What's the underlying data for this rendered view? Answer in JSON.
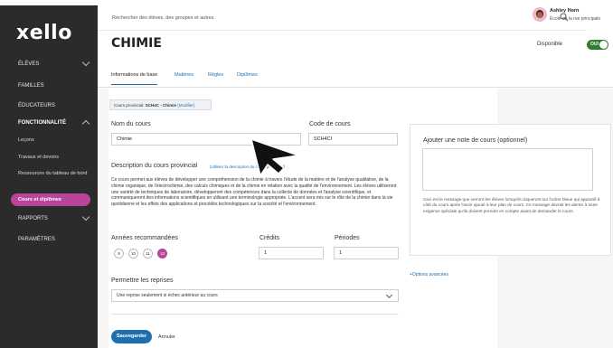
{
  "app": {
    "logo": "xello"
  },
  "sidebar": {
    "items": [
      {
        "label": "ÉLÈVES"
      },
      {
        "label": "FAMILLES"
      },
      {
        "label": "ÉDUCATEURS"
      },
      {
        "label": "FONCTIONNALITÉ"
      },
      {
        "label": "Leçons"
      },
      {
        "label": "Travaux et devoirs"
      },
      {
        "label": "Ressources du tableau de bord"
      },
      {
        "label": "Cours et diplômes"
      },
      {
        "label": "RAPPORTS"
      },
      {
        "label": "PARAMÈTRES"
      }
    ]
  },
  "header": {
    "search_placeholder": "Rechercher des élèves, des groupes et autres",
    "user_name": "Ashley Horn",
    "user_school": "École de la rue principale"
  },
  "page": {
    "title": "CHIMIE",
    "availability_label": "Disponible",
    "toggle_label": "OUI"
  },
  "tabs": [
    {
      "label": "Informations de base"
    },
    {
      "label": "Matières"
    },
    {
      "label": "Règles"
    },
    {
      "label": "Diplômes"
    }
  ],
  "form": {
    "prov_prefix": "Cours provincial: ",
    "prov_code": "SCH4C - Chimie",
    "prov_modify": "(Modifier)",
    "course_name_label": "Nom du cours",
    "course_name_value": "Chimie",
    "course_code_label": "Code de cours",
    "course_code_value": "SCH4CI",
    "desc_title": "Description du cours provincial",
    "desc_link": "(Utiliser la description du cours provincial)",
    "desc_text": "Ce cours permet aux élèves de développer une compréhension de la chimie à travers l'étude de la matière et de l'analyse qualitative, de la chimie organique, de l'électrochimie, des calculs chimiques et de la chimie en relation avec la qualité de l'environnement. Les élèves utiliseront une variété de techniques de laboratoire, développeront des compétences dans la collecte de données et l'analyse scientifique, et communiqueront des informations scientifiques en utilisant une terminologie appropriée. L'accent sera mis sur le rôle de la chimie dans la vie quotidienne et les effets des applications et procédés technologiques sur la société et l'environnement.",
    "grades_label": "Années recommandées",
    "grades": [
      "9",
      "10",
      "11",
      "12"
    ],
    "credits_label": "Crédits",
    "credits_value": "1",
    "periods_label": "Périodes",
    "periods_value": "1",
    "retakes_label": "Permettre les reprises",
    "retakes_value": "Une reprise seulement si échec antérieur au cours",
    "save_label": "Sauvegarder",
    "cancel_label": "Annuler"
  },
  "note": {
    "label": "Ajouter une note de cours (optionnel)",
    "help": "Ceci est le message que verront les élèves lorsqu'ils cliqueront sur l'icône bleue qui apparaît à côté du cours après l'avoir ajouté à leur plan de cours. Ce message devrait les alerter à toute exigence spéciale qu'ils doivent prendre en compte avant de demander le cours.",
    "advanced_link": "+Options avancées"
  },
  "colors": {
    "accent": "#1e6fb0",
    "sidebar": "#2b2b2b",
    "highlight": "#b9459a",
    "toggle": "#2e7d32"
  }
}
